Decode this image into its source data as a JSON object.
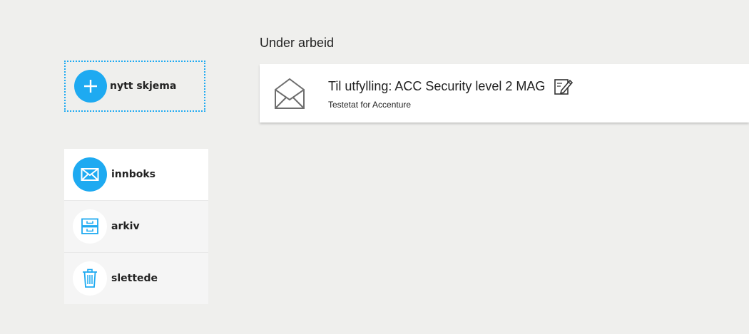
{
  "new_form": {
    "label": "nytt skjema",
    "icon": "plus-icon"
  },
  "sidebar": {
    "items": [
      {
        "label": "innboks",
        "icon": "mail-icon",
        "active": true
      },
      {
        "label": "arkiv",
        "icon": "archive-icon",
        "active": false
      },
      {
        "label": "slettede",
        "icon": "trash-icon",
        "active": false
      }
    ]
  },
  "main": {
    "section_title": "Under arbeid",
    "messages": [
      {
        "title": "Til utfylling: ACC Security level 2 MAG",
        "subtitle": "Testetat for Accenture",
        "icon": "envelope-open-icon",
        "action_icon": "edit-icon"
      }
    ]
  },
  "colors": {
    "accent": "#1eaaf1",
    "background": "#efefed",
    "card": "#ffffff",
    "text": "#222222"
  }
}
